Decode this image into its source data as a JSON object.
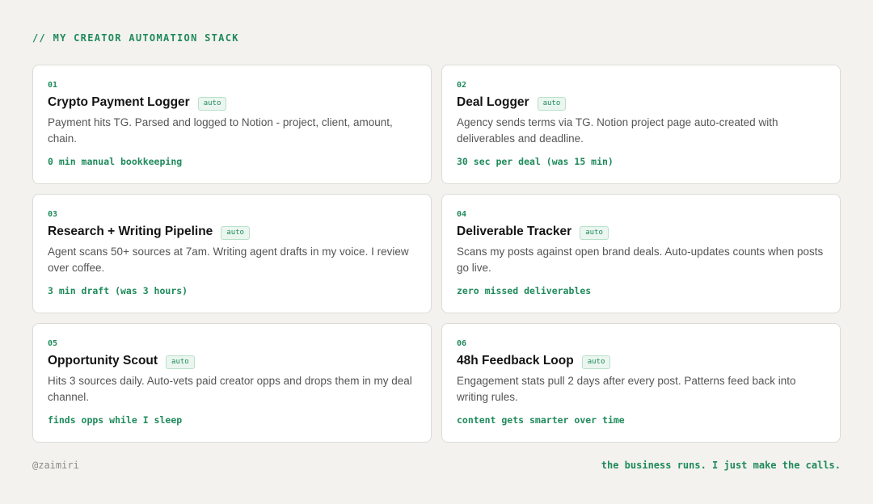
{
  "header": {
    "title": "// MY CREATOR AUTOMATION STACK"
  },
  "cards": [
    {
      "num": "01",
      "title": "Crypto Payment Logger",
      "badge": "auto",
      "desc": "Payment hits TG. Parsed and logged to Notion - project, client, amount, chain.",
      "metric": "0 min manual bookkeeping"
    },
    {
      "num": "02",
      "title": "Deal Logger",
      "badge": "auto",
      "desc": "Agency sends terms via TG. Notion project page auto-created with deliverables and deadline.",
      "metric": "30 sec per deal (was 15 min)"
    },
    {
      "num": "03",
      "title": "Research + Writing Pipeline",
      "badge": "auto",
      "desc": "Agent scans 50+ sources at 7am. Writing agent drafts in my voice. I review over coffee.",
      "metric": "3 min draft (was 3 hours)"
    },
    {
      "num": "04",
      "title": "Deliverable Tracker",
      "badge": "auto",
      "desc": "Scans my posts against open brand deals. Auto-updates counts when posts go live.",
      "metric": "zero missed deliverables"
    },
    {
      "num": "05",
      "title": "Opportunity Scout",
      "badge": "auto",
      "desc": "Hits 3 sources daily. Auto-vets paid creator opps and drops them in my deal channel.",
      "metric": "finds opps while I sleep"
    },
    {
      "num": "06",
      "title": "48h Feedback Loop",
      "badge": "auto",
      "desc": "Engagement stats pull 2 days after every post. Patterns feed back into writing rules.",
      "metric": "content gets smarter over time"
    }
  ],
  "footer": {
    "handle": "@zaimiri",
    "tagline": "the business runs. I just make the calls."
  },
  "colors": {
    "accent": "#1f8a5b",
    "background": "#f3f2ee",
    "card": "#ffffff"
  }
}
